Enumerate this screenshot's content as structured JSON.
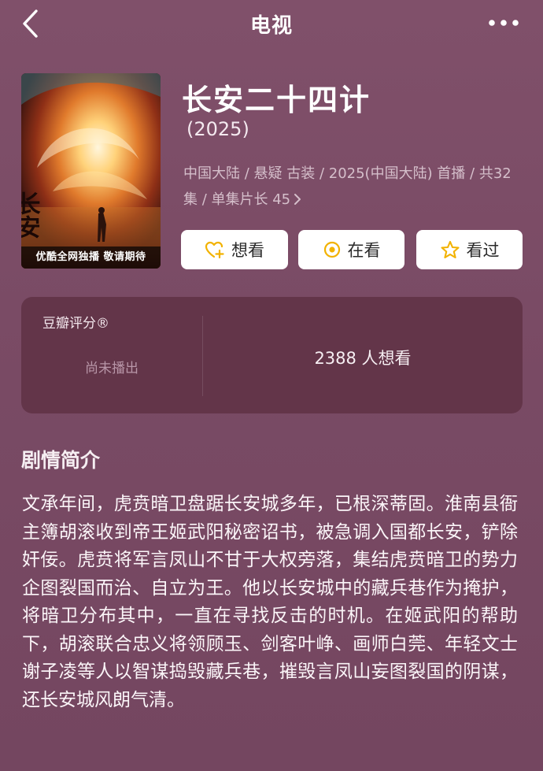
{
  "nav": {
    "title": "电视"
  },
  "poster": {
    "caption": "优酷全网独播 敬请期待",
    "vertical_title": "长安二十四计"
  },
  "show": {
    "title": "长安二十四计",
    "year": "(2025)",
    "meta": "中国大陆 / 悬疑 古装 / 2025(中国大陆) 首播 / 共32集 / 单集片长 45"
  },
  "actions": {
    "want": "想看",
    "watching": "在看",
    "watched": "看过"
  },
  "rating": {
    "label": "豆瓣评分®",
    "status": "尚未播出",
    "want_count": "2388 人想看"
  },
  "synopsis": {
    "heading": "剧情简介",
    "body": "文承年间，虎贲暗卫盘踞长安城多年，已根深蒂固。淮南县衙主簿胡滚收到帝王姬武阳秘密诏书，被急调入国都长安，铲除奸佞。虎贲将军言凤山不甘于大权旁落，集结虎贲暗卫的势力企图裂国而治、自立为王。他以长安城中的藏兵巷作为掩护，将暗卫分布其中，一直在寻找反击的时机。在姬武阳的帮助下，胡滚联合忠义将领顾玉、剑客叶峥、画师白莞、年轻文士谢子凌等人以智谋捣毁藏兵巷，摧毁言凤山妄图裂国的阴谋，还长安城风朗气清。"
  },
  "colors": {
    "background": "#7a4a62",
    "card": "#633549",
    "accent_yellow": "#f2b200"
  },
  "icons": {
    "back": "chevron-left-icon",
    "more": "more-dots-icon",
    "want": "heart-plus-icon",
    "watching": "target-circle-icon",
    "watched": "star-icon",
    "meta_more": "chevron-right-icon"
  }
}
